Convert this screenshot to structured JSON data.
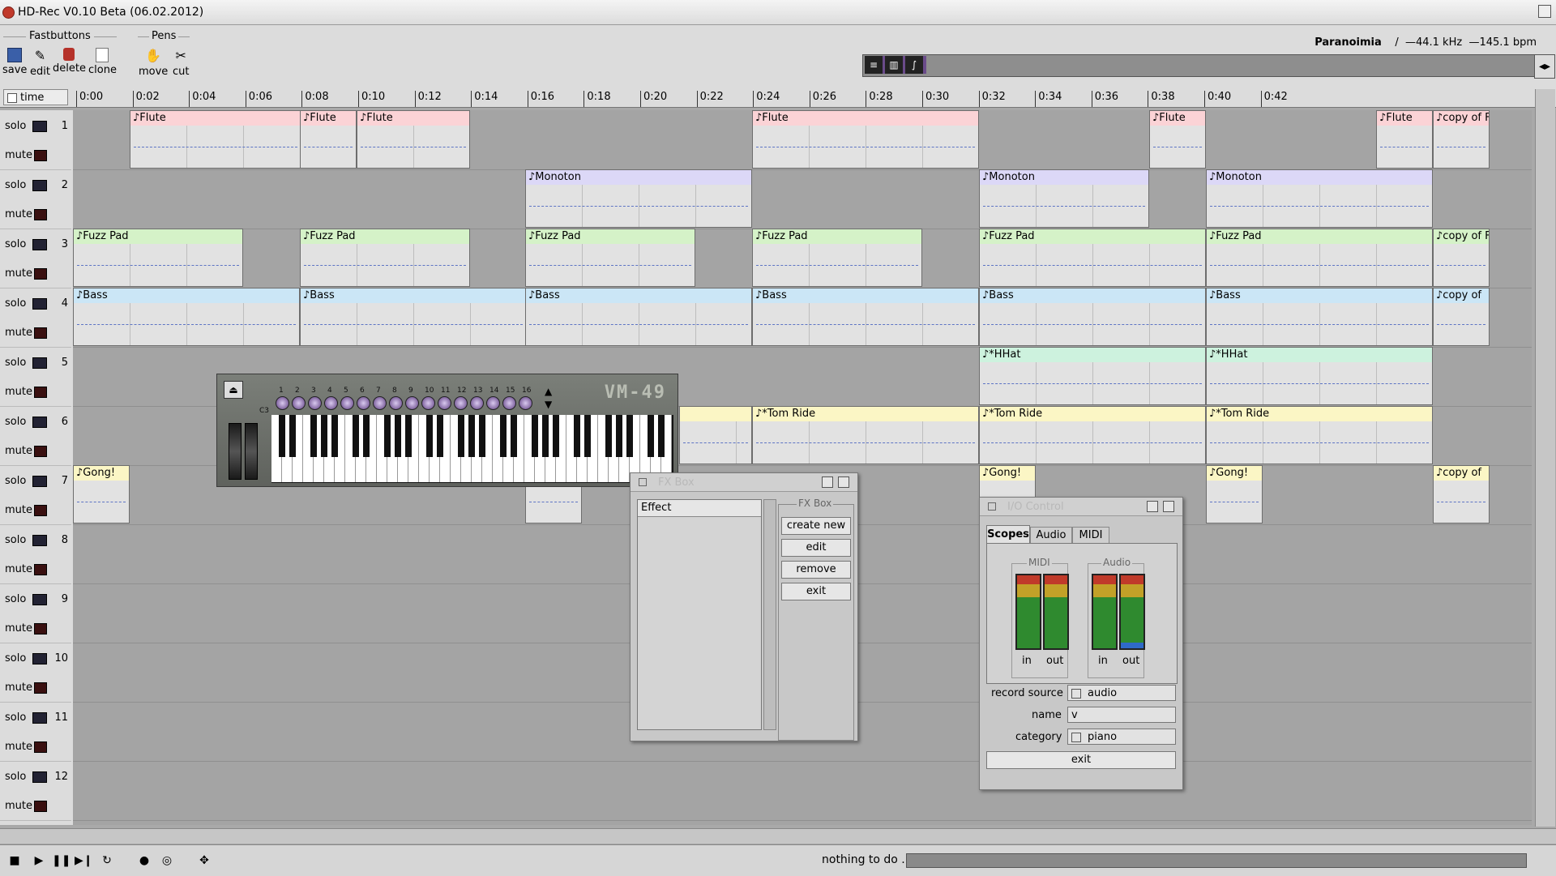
{
  "window": {
    "title": "HD-Rec V0.10 Beta (06.02.2012)"
  },
  "toolbar": {
    "fastbuttons_label": "Fastbuttons",
    "pens_label": "Pens",
    "buttons": [
      "save",
      "edit",
      "delete",
      "clone"
    ],
    "pens": [
      "move",
      "cut"
    ]
  },
  "song": {
    "name": "Paranoimia",
    "separator": "/",
    "rate": "44.1 kHz",
    "tempo": "145.1 bpm"
  },
  "ruler": {
    "label": "time",
    "ticks": [
      "0:00",
      "0:02",
      "0:04",
      "0:06",
      "0:08",
      "0:10",
      "0:12",
      "0:14",
      "0:16",
      "0:18",
      "0:20",
      "0:22",
      "0:24",
      "0:26",
      "0:28",
      "0:30",
      "0:32",
      "0:34",
      "0:36",
      "0:38",
      "0:40",
      "0:42"
    ]
  },
  "track_header": {
    "solo": "solo",
    "mute": "mute"
  },
  "tracks": [
    "1",
    "2",
    "3",
    "4",
    "5",
    "6",
    "7",
    "8",
    "9",
    "10",
    "11",
    "12"
  ],
  "clips": {
    "t1": [
      "♪Flute",
      "♪Flute",
      "♪Flute",
      "♪Flute",
      "♪Flute",
      "♪Flute",
      "♪copy of F"
    ],
    "t2": [
      "♪Monoton",
      "♪Monoton",
      "♪Monoton"
    ],
    "t3": [
      "♪Fuzz Pad",
      "♪Fuzz Pad",
      "♪Fuzz Pad",
      "♪Fuzz Pad",
      "♪Fuzz Pad",
      "♪Fuzz Pad",
      "♪copy of F"
    ],
    "t4": [
      "♪Bass",
      "♪Bass",
      "♪Bass",
      "♪Bass",
      "♪Bass",
      "♪Bass",
      "♪copy of"
    ],
    "t5": [
      "♪*HHat",
      "♪*HHat"
    ],
    "t6": [
      "♪*Tom Ride",
      "♪*Tom Ride",
      "♪*Tom Ride"
    ],
    "t7": [
      "♪Gong!",
      "♪Gong!",
      "♪Gong!",
      "♪copy of"
    ]
  },
  "keyboard": {
    "logo": "VM-49",
    "octave_label": "C3",
    "knob_numbers": [
      "1",
      "2",
      "3",
      "4",
      "5",
      "6",
      "7",
      "8",
      "9",
      "10",
      "11",
      "12",
      "13",
      "14",
      "15",
      "16"
    ]
  },
  "fx_box": {
    "title": "FX Box",
    "list_header": "Effect",
    "group_label": "FX Box",
    "buttons": {
      "create_new": "create new",
      "edit": "edit",
      "remove": "remove",
      "exit": "exit"
    }
  },
  "io_control": {
    "title": "I/O Control",
    "tabs": [
      "Scopes",
      "Audio",
      "MIDI"
    ],
    "midi_label": "MIDI",
    "audio_label": "Audio",
    "meter_labels": [
      "in",
      "out",
      "in",
      "out"
    ],
    "record_source_label": "record source",
    "record_source_value": "audio",
    "name_label": "name",
    "name_value": "v",
    "category_label": "category",
    "category_value": "piano",
    "exit_label": "exit"
  },
  "status": {
    "text": "nothing to do ..."
  },
  "colors": {
    "flute": "#fbd3d6",
    "monoton": "#dcd8f7",
    "fuzz_pad": "#d5f2c8",
    "bass": "#cbe6f6",
    "hhat": "#cdf2de",
    "tom_ride": "#fbf6c5"
  }
}
